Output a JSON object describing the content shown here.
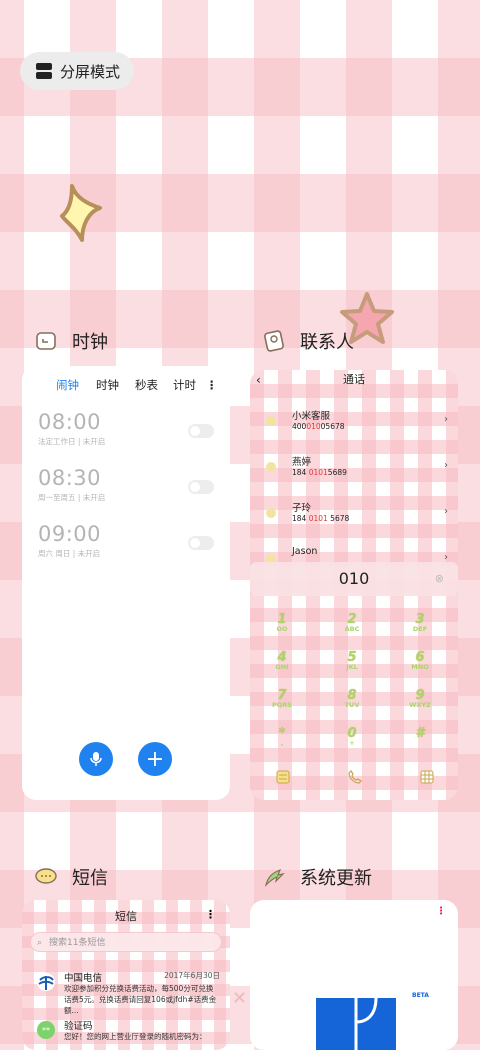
{
  "split_screen": {
    "label": "分屏模式"
  },
  "clock": {
    "title": "时钟",
    "tabs": [
      "闹钟",
      "时钟",
      "秒表",
      "计时"
    ],
    "alarms": [
      {
        "time": "08:00",
        "desc": "法定工作日 | 未开启"
      },
      {
        "time": "08:30",
        "desc": "周一至周五 | 未开启"
      },
      {
        "time": "09:00",
        "desc": "周六 周日 | 未开启"
      }
    ]
  },
  "contacts": {
    "title": "联系人",
    "screen_title": "通话",
    "entries": [
      {
        "name": "小米客服",
        "num_pre": "400",
        "num_hl": "010",
        "num_post": "05678"
      },
      {
        "name": "燕婷",
        "num_pre": "184 ",
        "num_hl": "0101",
        "num_post": "5689"
      },
      {
        "name": "子玲",
        "num_pre": "184 ",
        "num_hl": "0101",
        "num_post": " 5678"
      },
      {
        "name": "Jason",
        "num_pre": "",
        "num_hl": "",
        "num_post": ""
      }
    ],
    "dial_input": "010",
    "keys": [
      {
        "d": "1",
        "l": "OO"
      },
      {
        "d": "2",
        "l": "ABC"
      },
      {
        "d": "3",
        "l": "DEF"
      },
      {
        "d": "4",
        "l": "GHI"
      },
      {
        "d": "5",
        "l": "JKL"
      },
      {
        "d": "6",
        "l": "MNO"
      },
      {
        "d": "7",
        "l": "PQRS"
      },
      {
        "d": "8",
        "l": "TUV"
      },
      {
        "d": "9",
        "l": "WXYZ"
      },
      {
        "d": "*",
        "l": ","
      },
      {
        "d": "0",
        "l": "+"
      },
      {
        "d": "#",
        "l": ""
      }
    ]
  },
  "messages": {
    "title": "短信",
    "screen_title": "短信",
    "search_placeholder": "搜索11条短信",
    "items": [
      {
        "from": "中国电信",
        "date": "2017年6月30日",
        "body": "欢迎参加积分兑换话费活动，每500分可兑换话费5元。兑换话费请回复106或jfdh#话费金额..."
      },
      {
        "from": "验证码",
        "date": "",
        "body": "您好！您的网上营业厅登录的随机密码为："
      }
    ]
  },
  "update": {
    "title": "系统更新",
    "badge": "BETA"
  },
  "colors": {
    "accent": "#1f82ee",
    "pink": "#f6c2c8",
    "highlight": "#e03b3b"
  }
}
